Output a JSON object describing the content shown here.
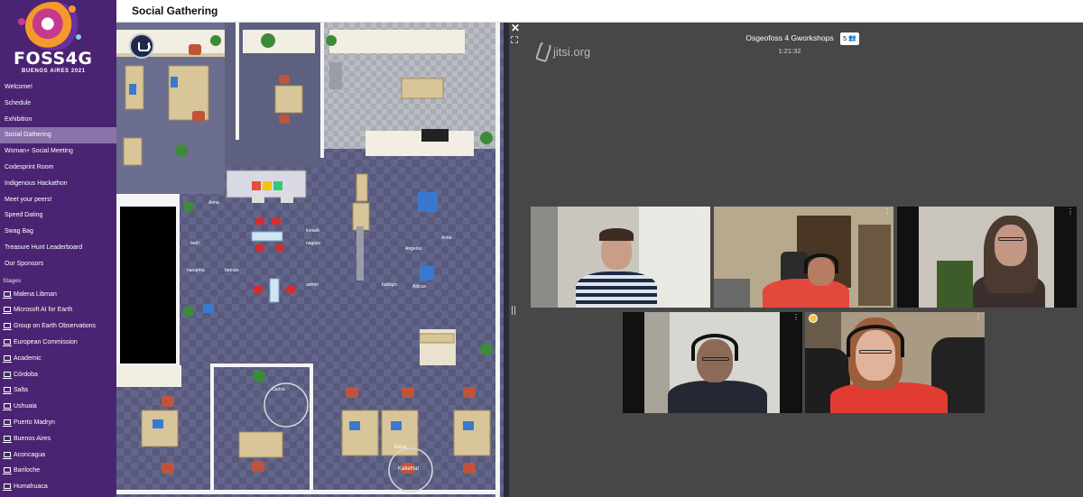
{
  "event": {
    "logo_text": "FOSS4G",
    "logo_subtitle": "BUENOS AIRES 2021"
  },
  "nav": {
    "items": [
      {
        "label": "Welcome!"
      },
      {
        "label": "Schedule"
      },
      {
        "label": "Exhibition"
      },
      {
        "label": "Social Gathering",
        "active": true
      },
      {
        "label": "Woman+ Social Meeting"
      },
      {
        "label": "Codesprint Room"
      },
      {
        "label": "Indigenous Hackathon"
      },
      {
        "label": "Meet your peers!"
      },
      {
        "label": "Speed Dating"
      },
      {
        "label": "Swag Bag"
      },
      {
        "label": "Treasure Hunt Leaderboard"
      },
      {
        "label": "Our Sponsors"
      }
    ]
  },
  "stages": {
    "title": "Stages",
    "items": [
      {
        "label": "Malena Libman"
      },
      {
        "label": "Microsoft AI for Earth"
      },
      {
        "label": "Group on Earth Observations"
      },
      {
        "label": "European Commission"
      },
      {
        "label": "Academic"
      },
      {
        "label": "Córdoba"
      },
      {
        "label": "Salta"
      },
      {
        "label": "Ushuaia"
      },
      {
        "label": "Puerto Madryn"
      },
      {
        "label": "Buenos Aires"
      },
      {
        "label": "Aconcagua"
      },
      {
        "label": "Bariloche"
      },
      {
        "label": "Humahuaca"
      }
    ]
  },
  "header": {
    "room_title": "Social Gathering"
  },
  "map": {
    "player_names": [
      "Anna",
      "fadri",
      "nanarma",
      "hernán",
      "konark",
      "naguez",
      "adrien",
      "Angelos",
      "Anita",
      "buktiglo",
      "Atticus",
      "Carlos",
      "Rickie",
      "KatieHat"
    ]
  },
  "jitsi": {
    "brand": "jitsi.org",
    "meeting_title": "Osgeofoss 4 Gworkshops",
    "participants_count": "5",
    "timer": "1:21:32"
  },
  "colors": {
    "sidebar_bg": "#4a2472",
    "sidebar_active": "#8c72aa",
    "jitsi_bg": "#474747",
    "map_floor": "#5e6184"
  }
}
